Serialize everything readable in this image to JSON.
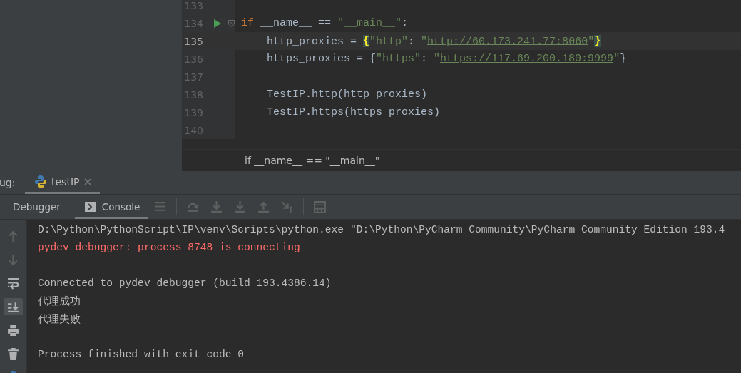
{
  "editor": {
    "lines": [
      {
        "number": "133",
        "current": false,
        "run": false,
        "fold": false
      },
      {
        "number": "134",
        "current": false,
        "run": true,
        "fold": true,
        "tokens": [
          {
            "kind": "keyword",
            "text": "if"
          },
          {
            "kind": "plain",
            "text": " __name__ == "
          },
          {
            "kind": "string",
            "text": "\"__main__\""
          },
          {
            "kind": "plain",
            "text": ":"
          }
        ]
      },
      {
        "number": "135",
        "current": true,
        "run": false,
        "fold": false,
        "tokens": [
          {
            "kind": "plain",
            "text": "    http_proxies = "
          },
          {
            "kind": "brace",
            "text": "{"
          },
          {
            "kind": "string",
            "text": "\"http\""
          },
          {
            "kind": "plain",
            "text": ": "
          },
          {
            "kind": "string",
            "text": "\""
          },
          {
            "kind": "link",
            "text": "http://60.173.241.77:8060"
          },
          {
            "kind": "string",
            "text": "\""
          },
          {
            "kind": "brace",
            "text": "}"
          }
        ]
      },
      {
        "number": "136",
        "current": false,
        "run": false,
        "fold": false,
        "tokens": [
          {
            "kind": "plain",
            "text": "    https_proxies = {"
          },
          {
            "kind": "string",
            "text": "\"https\""
          },
          {
            "kind": "plain",
            "text": ": "
          },
          {
            "kind": "string",
            "text": "\""
          },
          {
            "kind": "link",
            "text": "https://117.69.200.180:9999"
          },
          {
            "kind": "string",
            "text": "\""
          },
          {
            "kind": "plain",
            "text": "}"
          }
        ]
      },
      {
        "number": "137",
        "current": false,
        "run": false,
        "fold": false
      },
      {
        "number": "138",
        "current": false,
        "run": false,
        "fold": false,
        "tokens": [
          {
            "kind": "plain",
            "text": "    TestIP.http(http_proxies)"
          }
        ]
      },
      {
        "number": "139",
        "current": false,
        "run": false,
        "fold": false,
        "tokens": [
          {
            "kind": "plain",
            "text": "    TestIP.https(https_proxies)"
          }
        ]
      },
      {
        "number": "140",
        "current": false,
        "run": false,
        "fold": false
      }
    ],
    "breadcrumb": "if __name__ == \"__main__\""
  },
  "debug": {
    "label": "ug:",
    "tabs": [
      {
        "label": "testIP",
        "selected": true
      }
    ],
    "subtabs": [
      {
        "label": "Debugger",
        "selected": false
      },
      {
        "label": "Console",
        "selected": true
      }
    ],
    "console": [
      {
        "kind": "normal",
        "text": "D:\\Python\\PythonScript\\IP\\venv\\Scripts\\python.exe \"D:\\Python\\PyCharm Community\\PyCharm Community Edition 193.4"
      },
      {
        "kind": "error",
        "text": "pydev debugger: process 8748 is connecting"
      },
      {
        "kind": "blank"
      },
      {
        "kind": "normal",
        "text": "Connected to pydev debugger (build 193.4386.14)"
      },
      {
        "kind": "normal",
        "text": "代理成功"
      },
      {
        "kind": "normal",
        "text": "代理失败"
      },
      {
        "kind": "blank"
      },
      {
        "kind": "normal",
        "text": "Process finished with exit code 0"
      }
    ]
  }
}
